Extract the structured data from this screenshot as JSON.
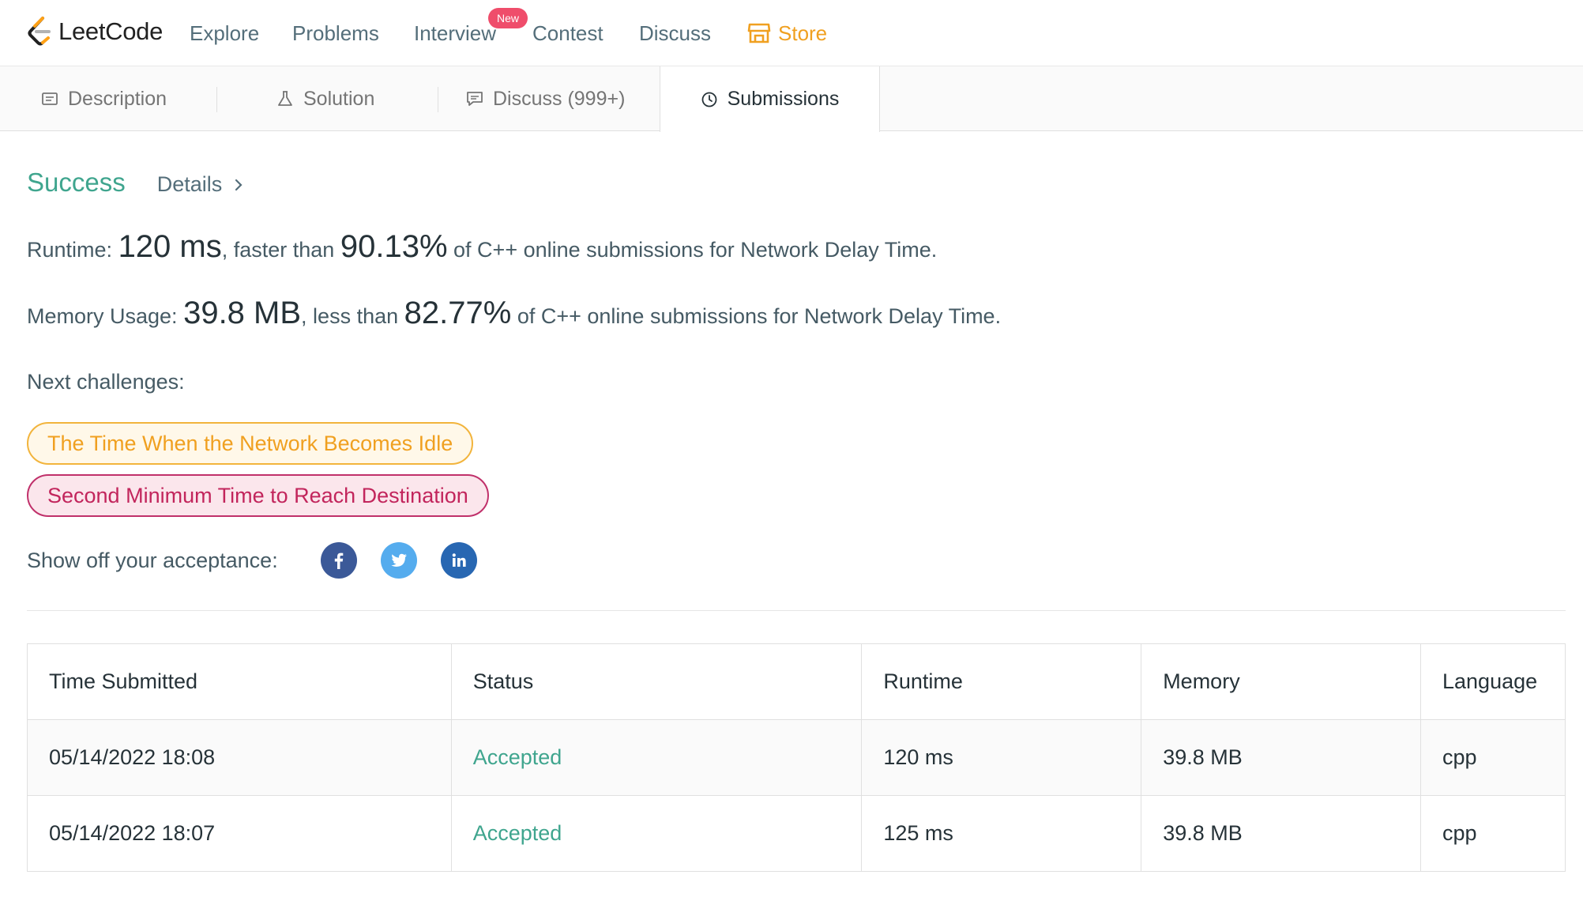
{
  "nav": {
    "logo_text": "LeetCode",
    "items": [
      "Explore",
      "Problems",
      "Interview",
      "Contest",
      "Discuss"
    ],
    "interview_badge": "New",
    "store": "Store"
  },
  "tabs": [
    {
      "label": "Description",
      "icon": "description-icon"
    },
    {
      "label": "Solution",
      "icon": "flask-icon"
    },
    {
      "label": "Discuss (999+)",
      "icon": "comment-icon"
    },
    {
      "label": "Submissions",
      "icon": "clock-icon",
      "active": true
    }
  ],
  "result": {
    "status": "Success",
    "details": "Details"
  },
  "runtime": {
    "label": "Runtime:",
    "value": "120 ms",
    "mid": ", faster than",
    "percent": "90.13%",
    "suffix": "of C++ online submissions for Network Delay Time."
  },
  "memory": {
    "label": "Memory Usage:",
    "value": "39.8 MB",
    "mid": ", less than",
    "percent": "82.77%",
    "suffix": "of C++ online submissions for Network Delay Time."
  },
  "next": {
    "label": "Next challenges:",
    "challenges": [
      {
        "title": "The Time When the Network Becomes Idle",
        "difficulty": "medium",
        "color": "#f0a020"
      },
      {
        "title": "Second Minimum Time to Reach Destination",
        "difficulty": "hard",
        "color": "#c2255c"
      }
    ]
  },
  "share": {
    "label": "Show off your acceptance:",
    "networks": [
      "facebook-icon",
      "twitter-icon",
      "linkedin-icon"
    ]
  },
  "table": {
    "headers": [
      "Time Submitted",
      "Status",
      "Runtime",
      "Memory",
      "Language"
    ],
    "rows": [
      [
        "05/14/2022 18:08",
        "Accepted",
        "120 ms",
        "39.8 MB",
        "cpp"
      ],
      [
        "05/14/2022 18:07",
        "Accepted",
        "125 ms",
        "39.8 MB",
        "cpp"
      ]
    ]
  },
  "colors": {
    "accent_green": "#3fa58e",
    "store_orange": "#f0a020",
    "badge_red": "#ef4d6b"
  }
}
